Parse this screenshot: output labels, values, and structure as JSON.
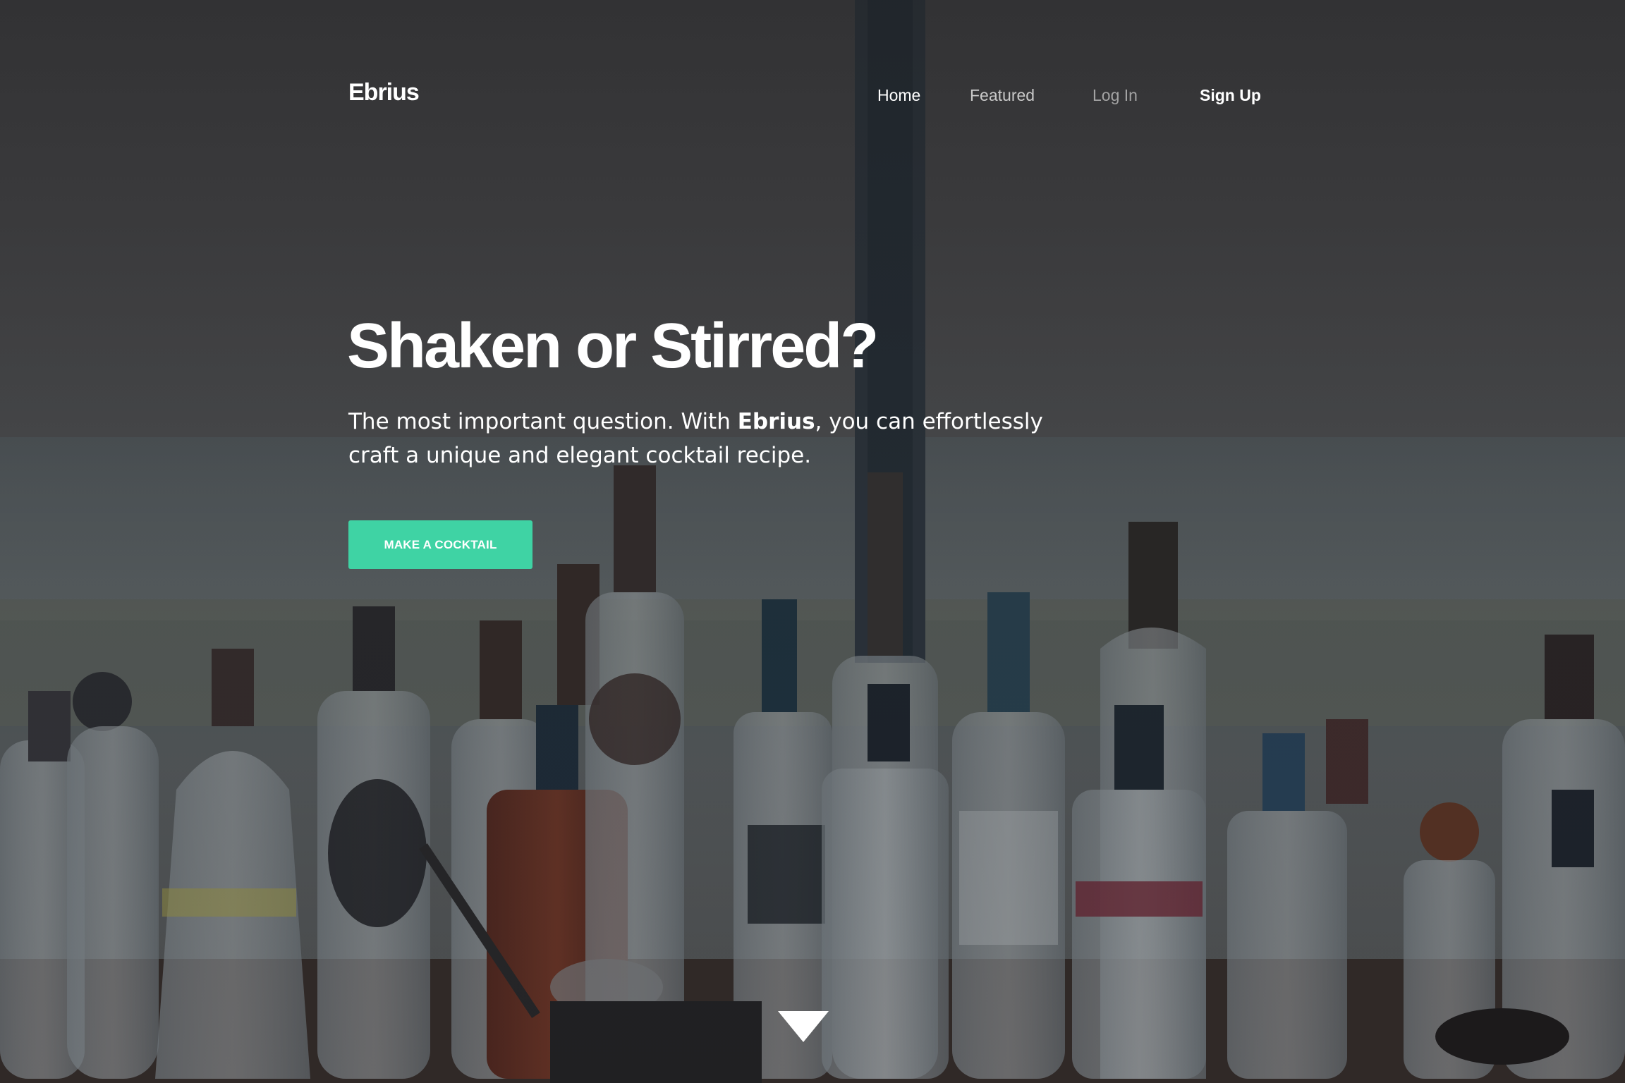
{
  "brand": {
    "name": "Ebrius"
  },
  "nav": {
    "items": [
      {
        "label": "Home"
      },
      {
        "label": "Featured"
      },
      {
        "label": "Log In"
      },
      {
        "label": "Sign Up"
      }
    ]
  },
  "hero": {
    "headline": "Shaken or Stirred?",
    "lead_before": "The most important question. With ",
    "lead_brand": "Ebrius",
    "lead_after": ", you can effortlessly craft a unique and elegant cocktail recipe.",
    "cta_label": "MAKE A COCKTAIL",
    "accent_color": "#3fd3a4"
  },
  "icons": {
    "scroll": "chevron-down-icon"
  }
}
